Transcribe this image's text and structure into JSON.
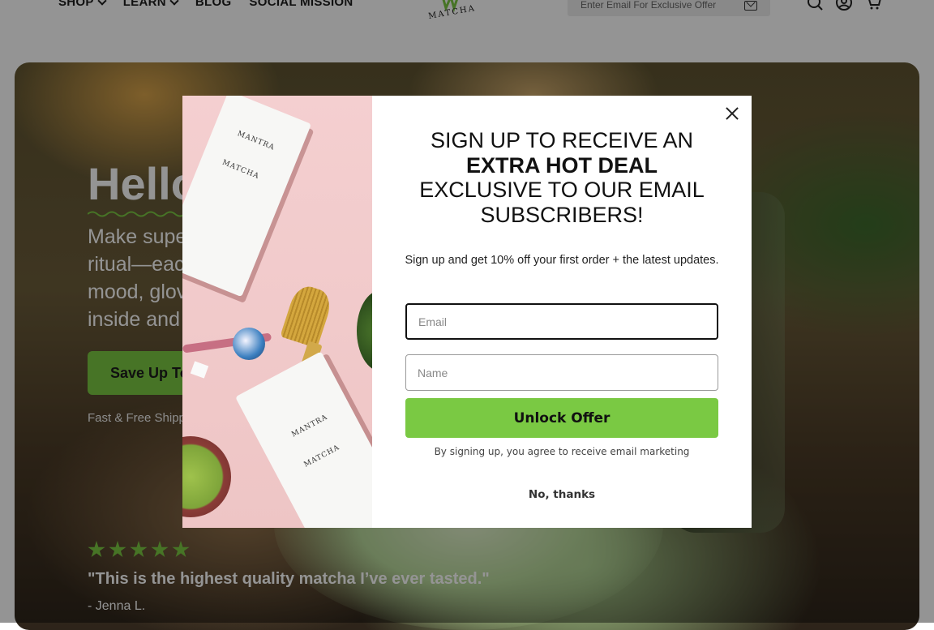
{
  "header": {
    "nav": [
      {
        "label": "SHOP",
        "has_dropdown": true
      },
      {
        "label": "LEARN",
        "has_dropdown": true
      },
      {
        "label": "BLOG",
        "has_dropdown": false
      },
      {
        "label": "SOCIAL MISSION",
        "has_dropdown": false
      }
    ],
    "logo_text": "MATCHA",
    "email_placeholder": "Enter Email For Exclusive Offer",
    "icons": [
      "search-icon",
      "account-icon",
      "cart-icon"
    ]
  },
  "hero": {
    "title": "Hello",
    "subtitle_lines": [
      "Make supe",
      "ritual—eac",
      "mood, glov",
      "inside and"
    ],
    "cta_label": "Save Up To",
    "shipping": "Fast & Free Shipp",
    "rating_stars": 5,
    "quote": "\"This is the highest quality matcha I’ve ever tasted.\"",
    "author": "- Jenna L."
  },
  "modal": {
    "headline_line1": "SIGN UP TO RECEIVE AN",
    "headline_line2": "EXTRA HOT DEAL",
    "headline_line3": "EXCLUSIVE TO OUR EMAIL",
    "headline_line4": "SUBSCRIBERS!",
    "subtext": "Sign up and get 10% off your first order + the latest updates.",
    "email_placeholder": "Email",
    "name_placeholder": "Name",
    "button_label": "Unlock Offer",
    "disclaimer": "By signing up, you agree to receive email marketing",
    "decline_label": "No, thanks",
    "pouch_brand": "MANTRA",
    "pouch_brand_sub": "MATCHA"
  },
  "colors": {
    "accent_green": "#7ac943",
    "modal_image_bg": "#f4cfd0"
  }
}
